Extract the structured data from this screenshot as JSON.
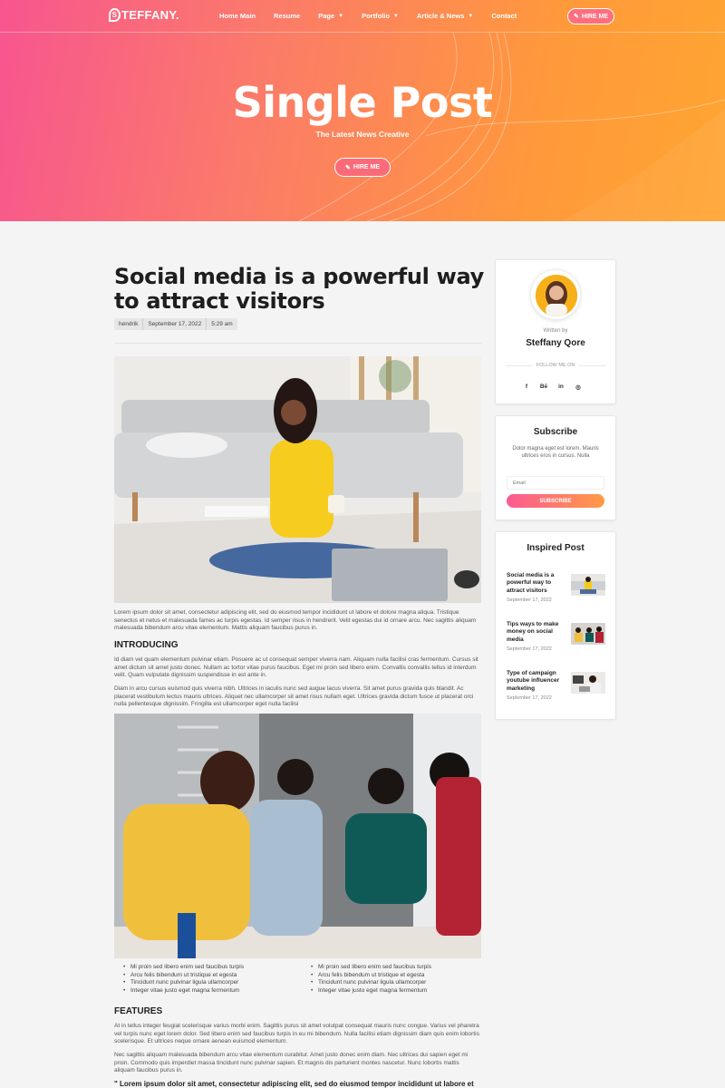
{
  "header": {
    "logo_letter": "S",
    "logo_text": "TEFFANY.",
    "nav": [
      {
        "label": "Home Main",
        "caret": false
      },
      {
        "label": "Resume",
        "caret": false
      },
      {
        "label": "Page",
        "caret": true
      },
      {
        "label": "Portfolio",
        "caret": true
      },
      {
        "label": "Article & News",
        "caret": true
      },
      {
        "label": "Contact",
        "caret": false
      }
    ],
    "hire_label": "HIRE ME",
    "hire_icon": "pen-nib-icon"
  },
  "hero": {
    "title": "Single Post",
    "subtitle": "The Latest News Creative",
    "button_label": "HIRE ME"
  },
  "article": {
    "title": "Social media is a powerful way to attract visitors",
    "meta": {
      "author": "hendrik",
      "date": "September 17, 2022",
      "time": "5:29 am"
    },
    "intro": "Lorem ipsum dolor sit amet, consectetur adipiscing elit, sed do eiusmod tempor incididunt ut labore et dolore magna aliqua. Tristique senectus et netus et malesuada fames ac turpis egestas. Id semper risus in hendrerit. Velit egestas dui id ornare arcu. Nec sagittis aliquam malesuada bibendum arcu vitae elementum. Mattis aliquam faucibus purus in.",
    "section1_heading": "INTRODUCING",
    "section1_p1": "Id diam vel quam elementum pulvinar etiam. Posuere ac ut consequat semper viverra nam. Aliquam nulla facilisi cras fermentum. Cursus sit amet dictum sit amet justo donec. Nullam ac tortor vitae purus faucibus. Eget mi proin sed libero enim. Convallis convallis tellus id interdum velit. Quam vulputate dignissim suspendisse in est ante in.",
    "section1_p2": "Diam in arcu cursus euismod quis viverra nibh. Ultrices in iaculis nunc sed augue lacus viverra. Sit amet purus gravida quis blandit. Ac placerat vestibulum lectus mauris ultrices. Aliquet nec ullamcorper sit amet risus nullam eget. Ultrices gravida dictum fusce ut placerat orci nulla pellentesque dignissim. Fringilla est ullamcorper eget nulla facilisi",
    "bullets_left": [
      "Mi proin sed libero enim sed faucibus turpis",
      "Arcu felis bibendum ut tristique et egesta",
      "Tincidunt nunc pulvinar ligula ullamcorper",
      "Integer vitae justo eget magna fermentum"
    ],
    "bullets_right": [
      "Mi proin sed libero enim sed faucibus turpis",
      "Arcu felis bibendum ut tristique et egesta",
      "Tincidunt nunc pulvinar ligula ullamcorper",
      "Integer vitae justo eget magna fermentum"
    ],
    "section2_heading": "FEATURES",
    "section2_p1": "At in tellus integer feugiat scelerisque varius morbi enim. Sagittis purus sit amet volutpat consequat mauris nunc congue. Varius vel pharetra vel turpis nunc eget lorem dolor. Sed libero enim sed faucibus turpis in eu mi bibendum. Nulla facilisi etiam dignissim diam quis enim lobortis scelerisque. Et ultrices neque ornare aenean euismod elementum.",
    "section2_p2": "Nec sagittis aliquam malesuada bibendum arcu vitae elementum curabitur. Amet justo donec enim diam. Nec ultrices dui sapien eget mi proin. Commodo quis imperdiet massa tincidunt nunc pulvinar sapien. Et magnis dis parturient montes nascetur. Nunc lobortis mattis aliquam faucibus purus in.",
    "quote": "\" Lorem ipsum dolor sit amet, consectetur adipiscing elit, sed do eiusmod tempor incididunt ut labore et"
  },
  "sidebar": {
    "author": {
      "written_by": "Written by",
      "name": "Steffany Qore",
      "follow_label": "FOLLOW ME ON",
      "socials": [
        {
          "label": "f",
          "icon": "facebook-icon"
        },
        {
          "label": "Bē",
          "icon": "behance-icon"
        },
        {
          "label": "in",
          "icon": "linkedin-icon"
        },
        {
          "label": "◎",
          "icon": "instagram-icon"
        }
      ]
    },
    "subscribe": {
      "title": "Subscribe",
      "text": "Dolor magna eget est lorem. Mauris ultrices eros in cursus. Nulla",
      "email_placeholder": "Email",
      "button_label": "SUBSCRIBE"
    },
    "inspired": {
      "title": "Inspired Post",
      "posts": [
        {
          "title": "Social media is a powerful way to attract visitors",
          "date": "September 17, 2022"
        },
        {
          "title": "Tips ways to make money on social media",
          "date": "September 17, 2022"
        },
        {
          "title": "Type of campaign youtube influencer marketing",
          "date": "September 17, 2022"
        }
      ]
    }
  },
  "colors": {
    "gradient_start": "#f7558f",
    "gradient_end": "#ffa532",
    "background": "#f4f4f4"
  }
}
